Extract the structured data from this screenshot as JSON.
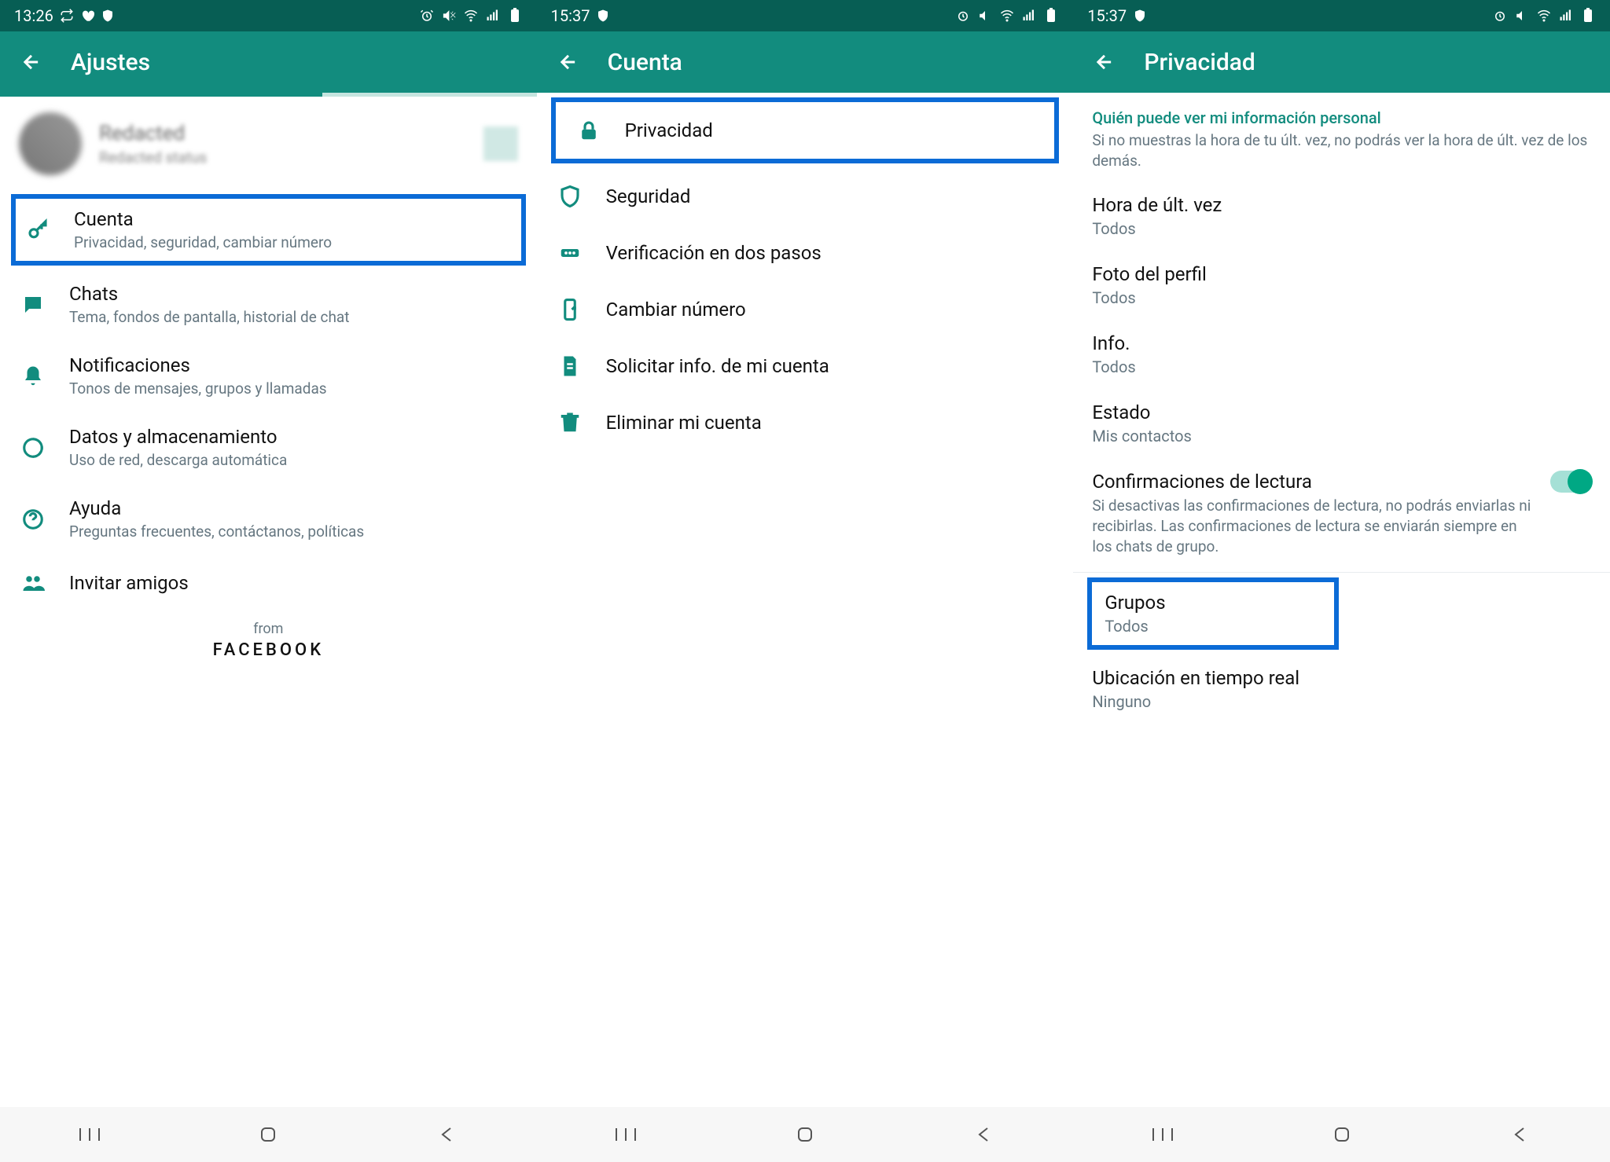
{
  "screen1": {
    "statusbar": {
      "time": "13:26"
    },
    "header": {
      "title": "Ajustes"
    },
    "profile": {
      "name": "Redacted",
      "status": "Redacted status"
    },
    "items": {
      "cuenta": {
        "label": "Cuenta",
        "sub": "Privacidad, seguridad, cambiar número"
      },
      "chats": {
        "label": "Chats",
        "sub": "Tema, fondos de pantalla, historial de chat"
      },
      "notif": {
        "label": "Notificaciones",
        "sub": "Tonos de mensajes, grupos y llamadas"
      },
      "datos": {
        "label": "Datos y almacenamiento",
        "sub": "Uso de red, descarga automática"
      },
      "ayuda": {
        "label": "Ayuda",
        "sub": "Preguntas frecuentes, contáctanos, políticas"
      },
      "invitar": {
        "label": "Invitar amigos"
      }
    },
    "footer": {
      "from": "from",
      "brand": "FACEBOOK"
    }
  },
  "screen2": {
    "statusbar": {
      "time": "15:37"
    },
    "header": {
      "title": "Cuenta"
    },
    "items": {
      "privacidad": "Privacidad",
      "seguridad": "Seguridad",
      "dospasos": "Verificación en dos pasos",
      "cambiar": "Cambiar número",
      "solicitar": "Solicitar info. de mi cuenta",
      "eliminar": "Eliminar mi cuenta"
    }
  },
  "screen3": {
    "statusbar": {
      "time": "15:37"
    },
    "header": {
      "title": "Privacidad"
    },
    "section": {
      "title": "Quién puede ver mi información personal",
      "sub": "Si no muestras la hora de tu últ. vez, no podrás ver la hora de últ. vez de los demás."
    },
    "items": {
      "lastseen": {
        "label": "Hora de últ. vez",
        "value": "Todos"
      },
      "foto": {
        "label": "Foto del perfil",
        "value": "Todos"
      },
      "info": {
        "label": "Info.",
        "value": "Todos"
      },
      "estado": {
        "label": "Estado",
        "value": "Mis contactos"
      },
      "lectura": {
        "label": "Confirmaciones de lectura",
        "sub": "Si desactivas las confirmaciones de lectura, no podrás enviarlas ni recibirlas. Las confirmaciones de lectura se enviarán siempre en los chats de grupo."
      },
      "grupos": {
        "label": "Grupos",
        "value": "Todos"
      },
      "ubicacion": {
        "label": "Ubicación en tiempo real",
        "value": "Ninguno"
      }
    }
  }
}
